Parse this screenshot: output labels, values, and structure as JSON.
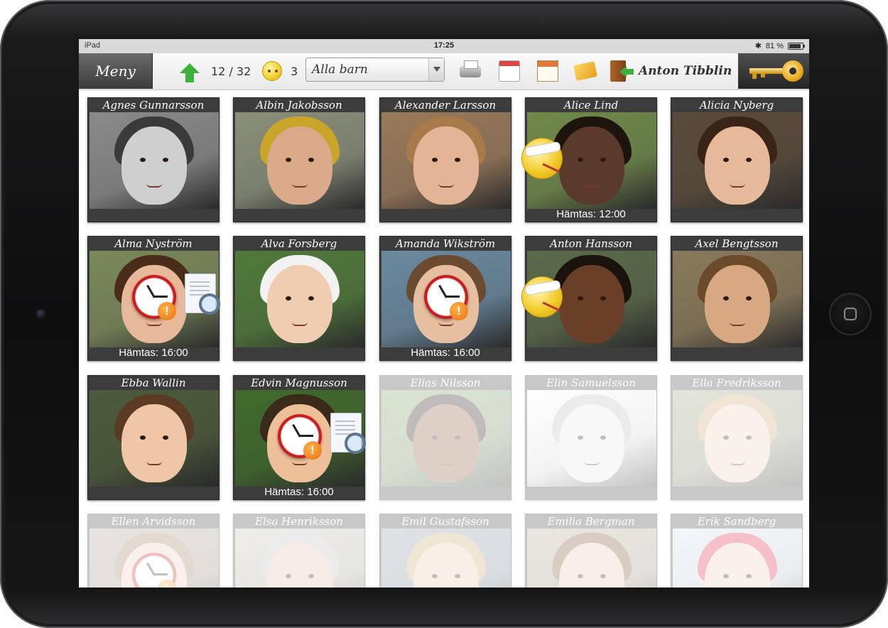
{
  "device": {
    "name": "iPad"
  },
  "statusbar": {
    "carrier": "iPad",
    "time": "17:25",
    "battery": "81 %"
  },
  "toolbar": {
    "menu_label": "Meny",
    "checked_in": "12 / 32",
    "sick_count": "3",
    "filter_value": "Alla barn",
    "user_name": "Anton Tibblin"
  },
  "colors": {
    "accent_green": "#3cb23c",
    "alert_orange": "#e8700b",
    "card_bg": "#3c3c3c"
  },
  "children": [
    {
      "name": "Agnes Gunnarsson",
      "pickup": "",
      "state": "present",
      "badges": []
    },
    {
      "name": "Albin Jakobsson",
      "pickup": "",
      "state": "present",
      "badges": []
    },
    {
      "name": "Alexander Larsson",
      "pickup": "",
      "state": "present",
      "badges": []
    },
    {
      "name": "Alice Lind",
      "pickup": "Hämtas: 12:00",
      "state": "present",
      "badges": [
        "sick-icon"
      ]
    },
    {
      "name": "Alicia Nyberg",
      "pickup": "",
      "state": "present",
      "badges": []
    },
    {
      "name": "Alma Nyström",
      "pickup": "Hämtas: 16:00",
      "state": "present",
      "badges": [
        "clock-alert-icon",
        "document-search-icon"
      ]
    },
    {
      "name": "Alva Forsberg",
      "pickup": "",
      "state": "present",
      "badges": []
    },
    {
      "name": "Amanda Wikström",
      "pickup": "Hämtas: 16:00",
      "state": "present",
      "badges": [
        "clock-alert-icon"
      ]
    },
    {
      "name": "Anton Hansson",
      "pickup": "",
      "state": "present",
      "badges": [
        "sick-icon"
      ]
    },
    {
      "name": "Axel Bengtsson",
      "pickup": "",
      "state": "present",
      "badges": []
    },
    {
      "name": "Ebba Wallin",
      "pickup": "",
      "state": "present",
      "badges": []
    },
    {
      "name": "Edvin Magnusson",
      "pickup": "Hämtas: 16:00",
      "state": "present",
      "badges": [
        "clock-alert-icon",
        "document-search-icon"
      ]
    },
    {
      "name": "Elias Nilsson",
      "pickup": "",
      "state": "absent",
      "badges": []
    },
    {
      "name": "Elin Samuelsson",
      "pickup": "",
      "state": "absent",
      "badges": []
    },
    {
      "name": "Ella Fredriksson",
      "pickup": "",
      "state": "absent",
      "badges": []
    },
    {
      "name": "Ellen Arvidsson",
      "pickup": "",
      "state": "absent",
      "badges": [
        "clock-alert-icon"
      ]
    },
    {
      "name": "Elsa Henriksson",
      "pickup": "",
      "state": "absent",
      "badges": []
    },
    {
      "name": "Emil Gustafsson",
      "pickup": "",
      "state": "absent",
      "badges": []
    },
    {
      "name": "Emilia Bergman",
      "pickup": "",
      "state": "absent",
      "badges": []
    },
    {
      "name": "Erik Sandberg",
      "pickup": "",
      "state": "absent",
      "badges": []
    }
  ]
}
